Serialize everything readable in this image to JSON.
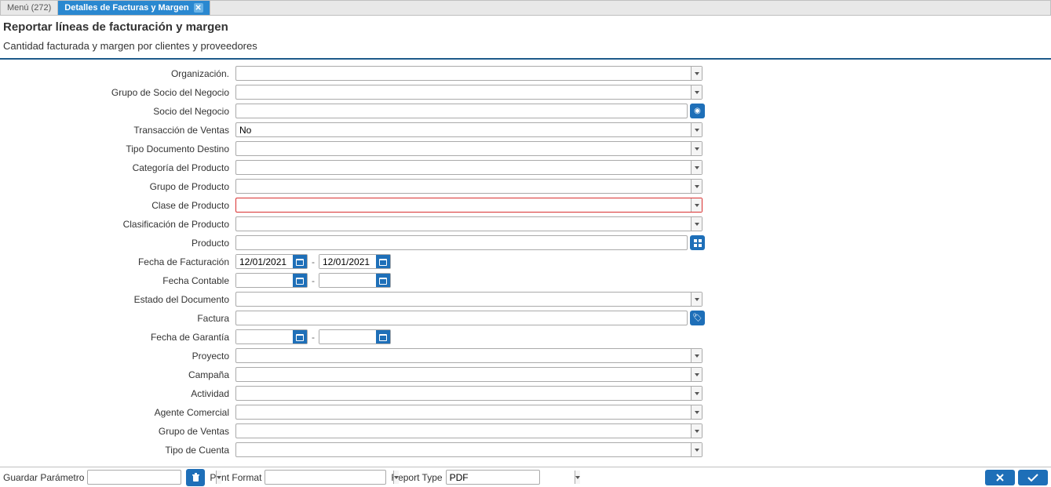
{
  "tabs": {
    "menu": "Menú (272)",
    "active": "Detalles de Facturas y Margen"
  },
  "header": {
    "title": "Reportar líneas de facturación y margen",
    "subtitle": "Cantidad facturada y margen por clientes y proveedores"
  },
  "fields": {
    "organizacion": {
      "label": "Organización.",
      "value": ""
    },
    "grupo_socio": {
      "label": "Grupo de Socio del Negocio",
      "value": ""
    },
    "socio": {
      "label": "Socio del Negocio",
      "value": ""
    },
    "trans_ventas": {
      "label": "Transacción de Ventas",
      "value": "No"
    },
    "tipo_doc_destino": {
      "label": "Tipo Documento Destino",
      "value": ""
    },
    "categoria_producto": {
      "label": "Categoría del Producto",
      "value": ""
    },
    "grupo_producto": {
      "label": "Grupo de Producto",
      "value": ""
    },
    "clase_producto": {
      "label": "Clase de Producto",
      "value": ""
    },
    "clasif_producto": {
      "label": "Clasificación de Producto",
      "value": ""
    },
    "producto": {
      "label": "Producto",
      "value": ""
    },
    "fecha_facturacion": {
      "label": "Fecha de Facturación",
      "from": "12/01/2021",
      "to": "12/01/2021"
    },
    "fecha_contable": {
      "label": "Fecha Contable",
      "from": "",
      "to": ""
    },
    "estado_documento": {
      "label": "Estado del Documento",
      "value": ""
    },
    "factura": {
      "label": "Factura",
      "value": ""
    },
    "fecha_garantia": {
      "label": "Fecha de Garantía",
      "from": "",
      "to": ""
    },
    "proyecto": {
      "label": "Proyecto",
      "value": ""
    },
    "campana": {
      "label": "Campaña",
      "value": ""
    },
    "actividad": {
      "label": "Actividad",
      "value": ""
    },
    "agente_comercial": {
      "label": "Agente Comercial",
      "value": ""
    },
    "grupo_ventas": {
      "label": "Grupo de Ventas",
      "value": ""
    },
    "tipo_cuenta": {
      "label": "Tipo de Cuenta",
      "value": ""
    }
  },
  "footer": {
    "save_param_label": "Guardar Parámetro",
    "save_param_value": "",
    "print_format_label": "Print Format",
    "print_format_value": "",
    "report_type_label": "Report Type",
    "report_type_value": "PDF"
  }
}
